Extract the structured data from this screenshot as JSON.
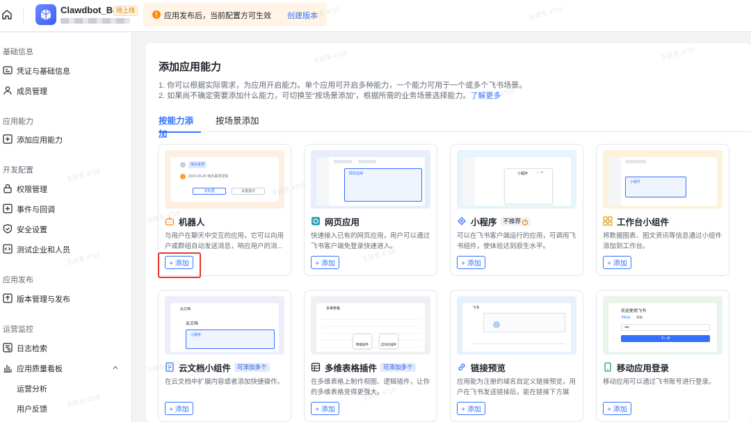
{
  "topbar": {
    "app_name": "Clawdbot_Bot",
    "app_status": "待上线",
    "notice_text": "应用发布后，当前配置方可生效",
    "notice_link": "创建版本"
  },
  "sidebar": {
    "sections": [
      {
        "title": "基础信息",
        "items": [
          "凭证与基础信息",
          "成员管理"
        ]
      },
      {
        "title": "应用能力",
        "items": [
          "添加应用能力"
        ]
      },
      {
        "title": "开发配置",
        "items": [
          "权限管理",
          "事件与回调",
          "安全设置",
          "测试企业和人员"
        ]
      },
      {
        "title": "应用发布",
        "items": [
          "版本管理与发布"
        ]
      },
      {
        "title": "运营监控",
        "items": [
          "日志检索",
          "应用质量看板"
        ],
        "sub_items": [
          "运营分析",
          "用户反馈"
        ]
      }
    ]
  },
  "main": {
    "title": "添加应用能力",
    "desc1": "1. 你可以根据实际需求，为应用开启能力。单个应用可开启多种能力，一个能力可用于一个或多个飞书场景。",
    "desc2": "2. 如果尚不确定需要添加什么能力，可切换至“按场景添加”，根据所需的业务场景选择能力。",
    "learn_more": "了解更多",
    "tabs": [
      "按能力添加",
      "按场景添加"
    ],
    "add_label": "+ 添加",
    "cards": [
      {
        "title": "机器人",
        "tag": "",
        "desc": "与用户在聊天中交互的应用，它可以向用户或群组自动发送消息，响应用户的消..."
      },
      {
        "title": "网页应用",
        "tag": "",
        "desc": "快速接入已有的网页应用，用户可以通过飞书客户端免登录快速进入。"
      },
      {
        "title": "小程序",
        "tag": "不推荐",
        "desc": "可以在飞书客户端运行的应用，可调用飞书组件，使体验达到原生水平。"
      },
      {
        "title": "工作台小组件",
        "tag": "",
        "desc": "将数据图表、图文资讯等信息通过小组件添加到工作台。"
      },
      {
        "title": "云文档小组件",
        "tag": "可添加多个",
        "desc": "在云文档中扩展内容或者添加快捷操作。"
      },
      {
        "title": "多维表格插件",
        "tag": "可添加多个",
        "desc": "在多维表格上制作视图、逻辑插件，让你的多维表格变得更强大。"
      },
      {
        "title": "链接预览",
        "tag": "",
        "desc": "应用能为注册的域名自定义链接预览，用户在飞书发送链接后，能在链接下方展示..."
      },
      {
        "title": "移动应用登录",
        "tag": "",
        "desc": "移动应用可以通过飞书账号进行登录。"
      }
    ]
  },
  "thumb_text": {
    "robot_chat": "待办事项",
    "robot_date": "2022-05-20 待办事项详情",
    "robot_btn1": "去处理",
    "robot_btn2": "设置提示",
    "web_app": "网页应用",
    "mini_title": "小程序",
    "widget_label": "小组件",
    "doc_title": "云文档",
    "doc_label": "小程序",
    "base_title": "多维表格",
    "base_btn1": "数据插件",
    "base_btn2": "自动化插件",
    "link_title": "飞书",
    "mobile_title": "欢迎使用飞书",
    "mobile_tab1": "手机号",
    "mobile_tab2": "邮箱",
    "mobile_code": "+86",
    "mobile_btn": "下一步"
  },
  "watermark": "王跃东 4719"
}
